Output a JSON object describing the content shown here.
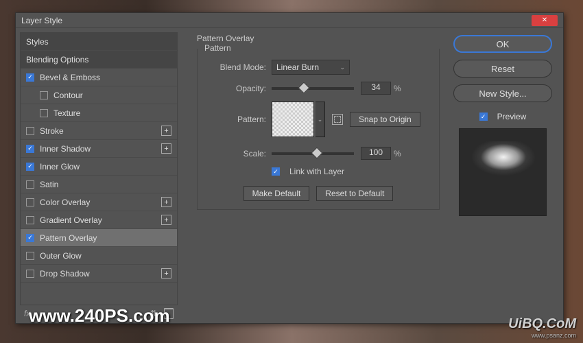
{
  "dialog": {
    "title": "Layer Style"
  },
  "effects": {
    "styles": "Styles",
    "blending": "Blending Options",
    "bevel": {
      "label": "Bevel & Emboss",
      "checked": true
    },
    "contour": {
      "label": "Contour",
      "checked": false
    },
    "texture": {
      "label": "Texture",
      "checked": false
    },
    "stroke": {
      "label": "Stroke",
      "checked": false,
      "plus": true
    },
    "innerShadow": {
      "label": "Inner Shadow",
      "checked": true,
      "plus": true
    },
    "innerGlow": {
      "label": "Inner Glow",
      "checked": true
    },
    "satin": {
      "label": "Satin",
      "checked": false
    },
    "colorOverlay": {
      "label": "Color Overlay",
      "checked": false,
      "plus": true
    },
    "gradientOverlay": {
      "label": "Gradient Overlay",
      "checked": false,
      "plus": true
    },
    "patternOverlay": {
      "label": "Pattern Overlay",
      "checked": true
    },
    "outerGlow": {
      "label": "Outer Glow",
      "checked": false
    },
    "dropShadow": {
      "label": "Drop Shadow",
      "checked": false,
      "plus": true
    }
  },
  "footer": {
    "fx": "fx"
  },
  "overlay": {
    "group": "Pattern Overlay",
    "legend": "Pattern",
    "blendLabel": "Blend Mode:",
    "blendValue": "Linear Burn",
    "opacityLabel": "Opacity:",
    "opacityValue": "34",
    "opacityUnit": "%",
    "patternLabel": "Pattern:",
    "snap": "Snap to Origin",
    "scaleLabel": "Scale:",
    "scaleValue": "100",
    "scaleUnit": "%",
    "linkLabel": "Link with Layer",
    "linkChecked": true,
    "makeDefault": "Make Default",
    "resetDefault": "Reset to Default"
  },
  "right": {
    "ok": "OK",
    "reset": "Reset",
    "newStyle": "New Style...",
    "previewLabel": "Preview",
    "previewChecked": true
  },
  "watermark": {
    "w1": "www.240PS.com",
    "w2": "UiBQ.CoM",
    "w2sub": "www.psanz.com"
  }
}
